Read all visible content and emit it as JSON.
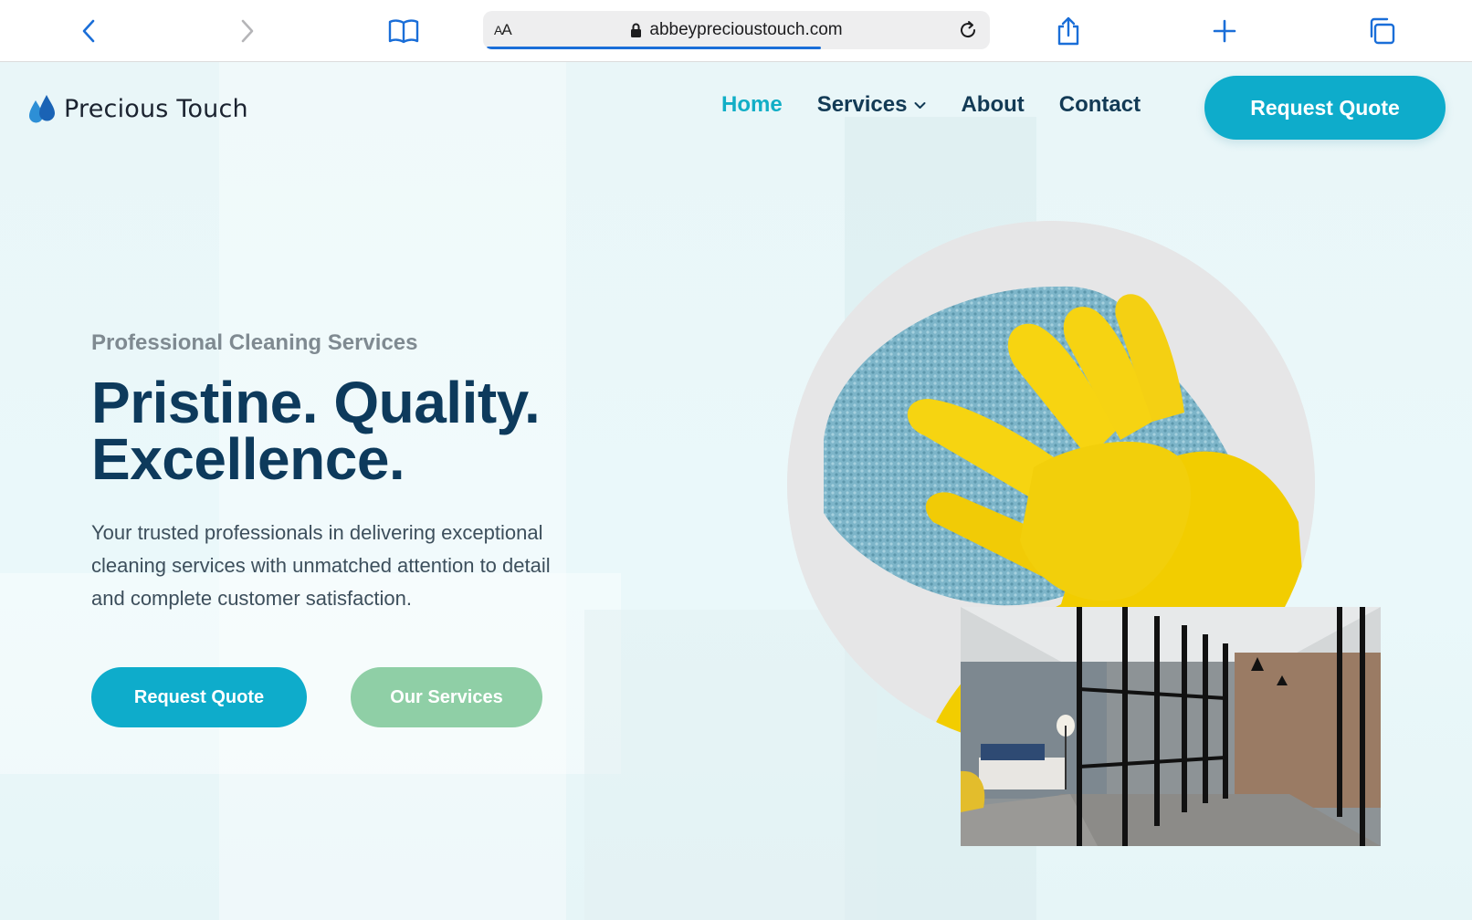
{
  "browser": {
    "address_prefix_large": "A",
    "address_prefix_small": "A",
    "url": "abbeyprecioustouch.com",
    "load_progress": 0.66
  },
  "nav": {
    "logo_text": "Precious Touch",
    "items": [
      {
        "label": "Home"
      },
      {
        "label": "Services"
      },
      {
        "label": "About"
      },
      {
        "label": "Contact"
      }
    ],
    "cta_label": "Request Quote"
  },
  "hero": {
    "kicker": "Professional Cleaning Services",
    "title_line1": "Pristine. Quality.",
    "title_line2": "Excellence.",
    "description": "Your trusted professionals in delivering exceptional cleaning services with unmatched attention to detail and complete customer satisfaction.",
    "primary_button": "Request Quote",
    "secondary_button": "Our Services"
  },
  "colors": {
    "accent": "#0eaccb",
    "navy": "#0d3a5c",
    "secondary_button": "#8fcfa6",
    "active_nav": "#11aec6"
  },
  "icons": [
    "back-icon",
    "forward-icon",
    "bookmarks-icon",
    "lock-icon",
    "reload-icon",
    "share-icon",
    "new-tab-icon",
    "tabs-icon",
    "water-drop-icon",
    "chevron-down-icon"
  ]
}
